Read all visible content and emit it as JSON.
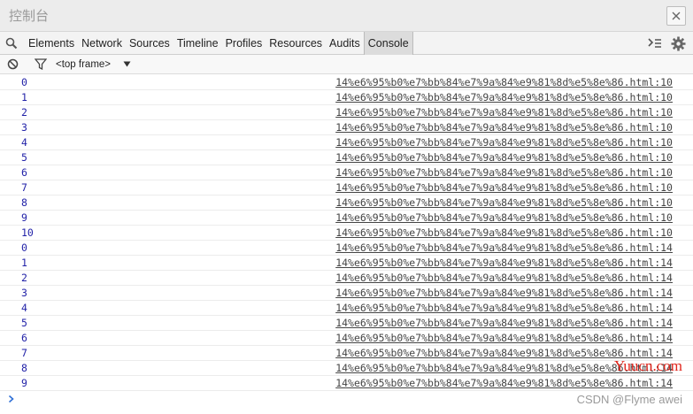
{
  "window": {
    "title": "控制台"
  },
  "tabs": [
    "Elements",
    "Network",
    "Sources",
    "Timeline",
    "Profiles",
    "Resources",
    "Audits",
    "Console"
  ],
  "active_tab": "Console",
  "toolbar": {
    "frame": "<top frame>"
  },
  "log": [
    {
      "value": "0",
      "source": "14%e6%95%b0%e7%bb%84%e7%9a%84%e9%81%8d%e5%8e%86.html:10"
    },
    {
      "value": "1",
      "source": "14%e6%95%b0%e7%bb%84%e7%9a%84%e9%81%8d%e5%8e%86.html:10"
    },
    {
      "value": "2",
      "source": "14%e6%95%b0%e7%bb%84%e7%9a%84%e9%81%8d%e5%8e%86.html:10"
    },
    {
      "value": "3",
      "source": "14%e6%95%b0%e7%bb%84%e7%9a%84%e9%81%8d%e5%8e%86.html:10"
    },
    {
      "value": "4",
      "source": "14%e6%95%b0%e7%bb%84%e7%9a%84%e9%81%8d%e5%8e%86.html:10"
    },
    {
      "value": "5",
      "source": "14%e6%95%b0%e7%bb%84%e7%9a%84%e9%81%8d%e5%8e%86.html:10"
    },
    {
      "value": "6",
      "source": "14%e6%95%b0%e7%bb%84%e7%9a%84%e9%81%8d%e5%8e%86.html:10"
    },
    {
      "value": "7",
      "source": "14%e6%95%b0%e7%bb%84%e7%9a%84%e9%81%8d%e5%8e%86.html:10"
    },
    {
      "value": "8",
      "source": "14%e6%95%b0%e7%bb%84%e7%9a%84%e9%81%8d%e5%8e%86.html:10"
    },
    {
      "value": "9",
      "source": "14%e6%95%b0%e7%bb%84%e7%9a%84%e9%81%8d%e5%8e%86.html:10"
    },
    {
      "value": "10",
      "source": "14%e6%95%b0%e7%bb%84%e7%9a%84%e9%81%8d%e5%8e%86.html:10"
    },
    {
      "value": "0",
      "source": "14%e6%95%b0%e7%bb%84%e7%9a%84%e9%81%8d%e5%8e%86.html:14"
    },
    {
      "value": "1",
      "source": "14%e6%95%b0%e7%bb%84%e7%9a%84%e9%81%8d%e5%8e%86.html:14"
    },
    {
      "value": "2",
      "source": "14%e6%95%b0%e7%bb%84%e7%9a%84%e9%81%8d%e5%8e%86.html:14"
    },
    {
      "value": "3",
      "source": "14%e6%95%b0%e7%bb%84%e7%9a%84%e9%81%8d%e5%8e%86.html:14"
    },
    {
      "value": "4",
      "source": "14%e6%95%b0%e7%bb%84%e7%9a%84%e9%81%8d%e5%8e%86.html:14"
    },
    {
      "value": "5",
      "source": "14%e6%95%b0%e7%bb%84%e7%9a%84%e9%81%8d%e5%8e%86.html:14"
    },
    {
      "value": "6",
      "source": "14%e6%95%b0%e7%bb%84%e7%9a%84%e9%81%8d%e5%8e%86.html:14"
    },
    {
      "value": "7",
      "source": "14%e6%95%b0%e7%bb%84%e7%9a%84%e9%81%8d%e5%8e%86.html:14"
    },
    {
      "value": "8",
      "source": "14%e6%95%b0%e7%bb%84%e7%9a%84%e9%81%8d%e5%8e%86.html:14"
    },
    {
      "value": "9",
      "source": "14%e6%95%b0%e7%bb%84%e7%9a%84%e9%81%8d%e5%8e%86.html:14"
    }
  ],
  "watermark": {
    "site": "Yuucn.com",
    "author": "CSDN @Flyme awei"
  },
  "colors": {
    "log_value": "#2222a8",
    "watermark_site": "#e0241b"
  },
  "icons": {
    "search": "search-icon",
    "close": "close-icon",
    "clear": "clear-console-icon",
    "filter": "filter-icon",
    "dock": "dock-icon",
    "settings": "gear-icon",
    "prompt": "prompt-chevron-icon",
    "dropdown": "dropdown-caret-icon"
  }
}
